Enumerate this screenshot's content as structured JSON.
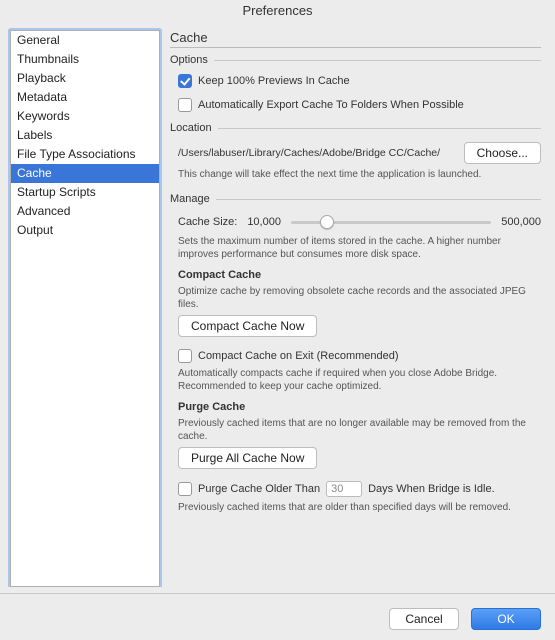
{
  "window": {
    "title": "Preferences"
  },
  "sidebar": {
    "items": [
      {
        "label": "General"
      },
      {
        "label": "Thumbnails"
      },
      {
        "label": "Playback"
      },
      {
        "label": "Metadata"
      },
      {
        "label": "Keywords"
      },
      {
        "label": "Labels"
      },
      {
        "label": "File Type Associations"
      },
      {
        "label": "Cache",
        "selected": true
      },
      {
        "label": "Startup Scripts"
      },
      {
        "label": "Advanced"
      },
      {
        "label": "Output"
      }
    ]
  },
  "panel": {
    "title": "Cache",
    "options": {
      "group_title": "Options",
      "keep_previews": {
        "checked": true,
        "label": "Keep 100% Previews In Cache"
      },
      "auto_export": {
        "checked": false,
        "label": "Automatically Export Cache To Folders When Possible"
      }
    },
    "location": {
      "group_title": "Location",
      "path": "/Users/labuser/Library/Caches/Adobe/Bridge CC/Cache/",
      "choose_label": "Choose...",
      "note": "This change will take effect the next time the application is launched."
    },
    "manage": {
      "group_title": "Manage",
      "cache_size_label": "Cache Size:",
      "slider_min_label": "10,000",
      "slider_max_label": "500,000",
      "size_help": "Sets the maximum number of items stored in the cache. A higher number improves performance but consumes more disk space.",
      "compact_heading": "Compact Cache",
      "compact_help": "Optimize cache by removing obsolete cache records and the associated JPEG files.",
      "compact_now_label": "Compact Cache Now",
      "compact_on_exit": {
        "checked": false,
        "label": "Compact Cache on Exit (Recommended)"
      },
      "compact_on_exit_help": "Automatically compacts cache if required when you close Adobe Bridge. Recommended to keep your cache optimized.",
      "purge_heading": "Purge Cache",
      "purge_help": "Previously cached items that are no longer available may be removed from the cache.",
      "purge_all_label": "Purge All Cache Now",
      "purge_older": {
        "checked": false,
        "prefix": "Purge Cache Older Than",
        "value": "30",
        "suffix": "Days When Bridge is Idle."
      },
      "purge_older_help": "Previously cached items that are older than specified days will be removed."
    }
  },
  "footer": {
    "cancel": "Cancel",
    "ok": "OK"
  }
}
